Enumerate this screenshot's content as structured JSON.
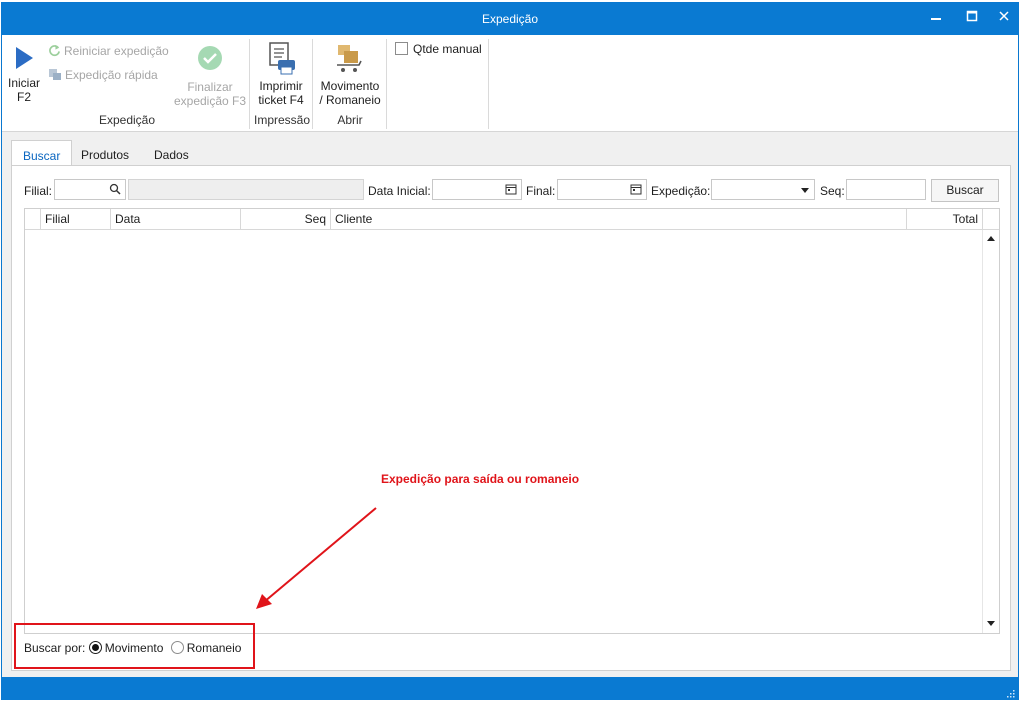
{
  "window": {
    "title": "Expedição",
    "minimize_icon": "minimize-icon",
    "maximize_icon": "maximize-icon",
    "close_icon": "close-icon",
    "accent_color": "#0a7ad2"
  },
  "ribbon": {
    "expedicao_group": {
      "label": "Expedição",
      "iniciar_line1": "Iniciar",
      "iniciar_line2": "F2",
      "reiniciar": "Reiniciar expedição",
      "rapida": "Expedição rápida",
      "finalizar_line1": "Finalizar",
      "finalizar_line2": "expedição F3"
    },
    "impressao_group": {
      "label": "Impressão",
      "imprimir_line1": "Imprimir",
      "imprimir_line2": "ticket F4"
    },
    "abrir_group": {
      "label": "Abrir",
      "movimento_line1": "Movimento",
      "movimento_line2": "/ Romaneio"
    },
    "qtde_manual": "Qtde manual"
  },
  "tabs": [
    {
      "label": "Buscar",
      "active": true
    },
    {
      "label": "Produtos",
      "active": false
    },
    {
      "label": "Dados",
      "active": false
    }
  ],
  "filters": {
    "filial_label": "Filial:",
    "filial_value": "",
    "filial_name_value": "",
    "data_inicial_label": "Data Inicial:",
    "data_inicial_value": "",
    "final_label": "Final:",
    "final_value": "",
    "expedicao_label": "Expedição:",
    "expedicao_value": "",
    "seq_label": "Seq:",
    "seq_value": "",
    "buscar_button": "Buscar"
  },
  "grid": {
    "columns": [
      "Filial",
      "Data",
      "Seq",
      "Cliente",
      "Total"
    ],
    "rows": []
  },
  "annotation": {
    "text": "Expedição para saída ou romaneio",
    "color": "#e0141a"
  },
  "search_by": {
    "label": "Buscar por:",
    "options": [
      {
        "label": "Movimento",
        "selected": true
      },
      {
        "label": "Romaneio",
        "selected": false
      }
    ]
  }
}
